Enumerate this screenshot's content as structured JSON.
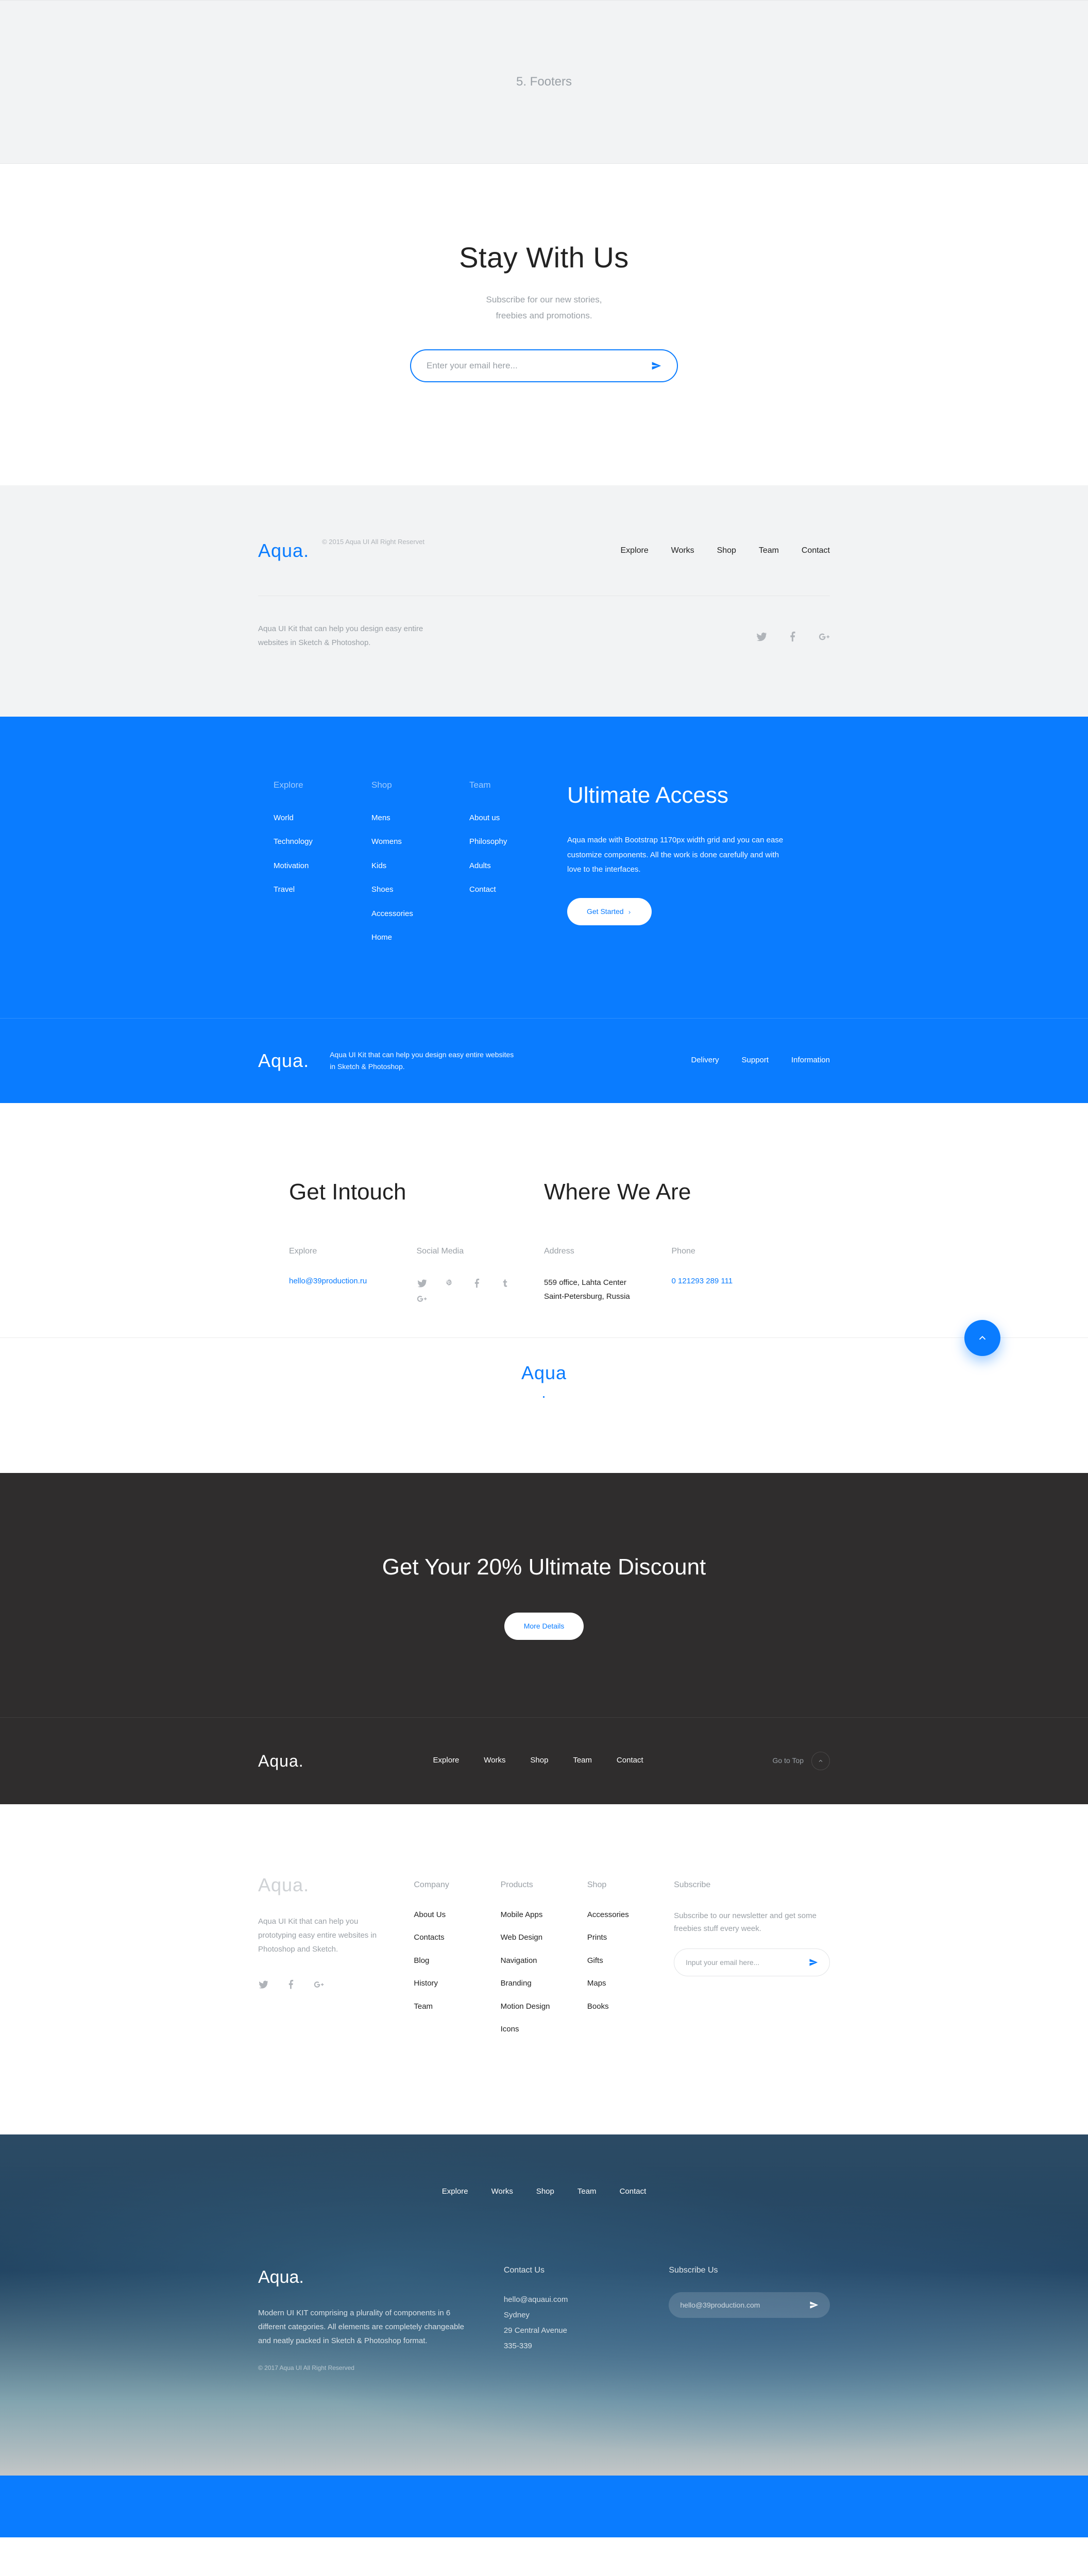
{
  "section_header": "5. Footers",
  "stay": {
    "title": "Stay With Us",
    "sub1": "Subscribe for our new stories,",
    "sub2": "freebies and promotions.",
    "placeholder": "Enter your email here..."
  },
  "greyFooter": {
    "logo": "Aqua.",
    "copyright": "© 2015 Aqua UI All Right Reservet",
    "nav": [
      "Explore",
      "Works",
      "Shop",
      "Team",
      "Contact"
    ],
    "blurb": "Aqua UI Kit that can help you design easy entire websites in Sketch & Photoshop."
  },
  "blueBig": {
    "cols": {
      "explore": {
        "head": "Explore",
        "items": [
          "World",
          "Technology",
          "Motivation",
          "Travel"
        ]
      },
      "shop": {
        "head": "Shop",
        "items": [
          "Mens",
          "Womens",
          "Kids",
          "Shoes",
          "Accessories",
          "Home"
        ]
      },
      "team": {
        "head": "Team",
        "items": [
          "About us",
          "Philosophy",
          "Adults",
          "Contact"
        ]
      }
    },
    "cta_title": "Ultimate Access",
    "cta_text": "Aqua made with Bootstrap 1170px width grid and you can ease customize components. All the work is done carefully and with love to the interfaces.",
    "cta_btn": "Get Started"
  },
  "blueBar": {
    "logo": "Aqua.",
    "blurb": "Aqua UI Kit that can help you design easy entire websites in Sketch & Photoshop.",
    "links": [
      "Delivery",
      "Support",
      "Information"
    ]
  },
  "whiteFooter": {
    "left_title": "Get Intouch",
    "right_title": "Where We Are",
    "explore_lbl": "Explore",
    "email": "hello@39production.ru",
    "social_lbl": "Social Media",
    "address_lbl": "Address",
    "addr1": "559 office, Lahta Center",
    "addr2": "Saint-Petersburg, Russia",
    "phone_lbl": "Phone",
    "phone": "0 121293 289 111",
    "logo": "Aqua\n."
  },
  "darkDisc": {
    "title": "Get Your 20% Ultimate Discount",
    "btn": "More Details",
    "logo": "Aqua.",
    "nav": [
      "Explore",
      "Works",
      "Shop",
      "Team",
      "Contact"
    ],
    "goto": "Go to Top"
  },
  "white4": {
    "logo": "Aqua.",
    "desc": "Aqua UI Kit that can help you prototyping easy entire websites in Photoshop and Sketch.",
    "company": {
      "head": "Company",
      "items": [
        "About Us",
        "Contacts",
        "Blog",
        "History",
        "Team"
      ]
    },
    "products": {
      "head": "Products",
      "items": [
        "Mobile Apps",
        "Web Design",
        "Navigation",
        "Branding",
        "Motion Design",
        "Icons"
      ]
    },
    "shop": {
      "head": "Shop",
      "items": [
        "Accessories",
        "Prints",
        "Gifts",
        "Maps",
        "Books"
      ]
    },
    "sub_head": "Subscribe",
    "sub_text": "Subscribe to our newsletter and get some freebies stuff every week.",
    "sub_ph": "Input your email here..."
  },
  "photoFooter": {
    "nav": [
      "Explore",
      "Works",
      "Shop",
      "Team",
      "Contact"
    ],
    "logo": "Aqua.",
    "body": "Modern UI KIT comprising a plurality of components in 6 different categories. All elements are completely changeable and neatly packed in Sketch & Photoshop format.",
    "tiny": "© 2017 Aqua UI All Right Reserved",
    "contact_head": "Contact Us",
    "contact": [
      "hello@aquaui.com",
      "Sydney",
      "29 Central Avenue",
      "335-339"
    ],
    "sub_head": "Subscribe Us",
    "sub_ph": "hello@39production.com"
  }
}
